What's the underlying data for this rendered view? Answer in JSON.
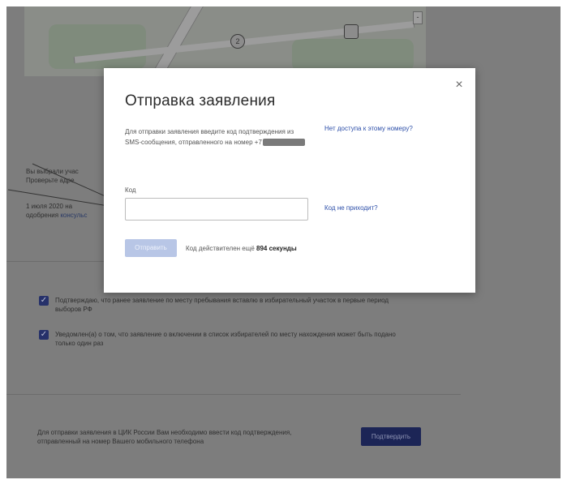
{
  "background": {
    "map": {
      "marker_label": "2",
      "zoom_label": "-"
    },
    "info": {
      "selected_text": "Вы выбрали учас",
      "selected_sub": "Проверьте адре",
      "date_text": "1 июля 2020 на",
      "approval_text": "одобрения",
      "approval_link": "консульс"
    },
    "checkboxes": [
      {
        "text": "Подтверждаю, что ранее заявление по месту пребывания вставлю в избирательный участок в первые период выборов РФ"
      },
      {
        "text": "Уведомлен(а) о том, что заявление о включении в список избирателей по месту нахождения может быть подано только один раз"
      }
    ],
    "footer": {
      "text": "Для отправки заявления в ЦИК России Вам необходимо ввести код подтверждения, отправленный на номер Вашего мобильного телефона",
      "confirm_label": "Подтвердить"
    }
  },
  "modal": {
    "title": "Отправка заявления",
    "description": "Для отправки заявления введите код подтверждения из SMS-сообщения, отправленного на номер +7",
    "no_access_link": "Нет доступа к этому номеру?",
    "code_label": "Код",
    "code_value": "",
    "code_placeholder": "",
    "no_code_link": "Код не приходит?",
    "send_label": "Отправить",
    "timer_prefix": "Код действителен ещё",
    "timer_value": "894 секунды",
    "close_glyph": "×"
  },
  "colors": {
    "accent": "#2c4ea8",
    "send_disabled": "#b8c6e6",
    "overlay": "#7d7d7d",
    "checkbox": "#26316a"
  }
}
